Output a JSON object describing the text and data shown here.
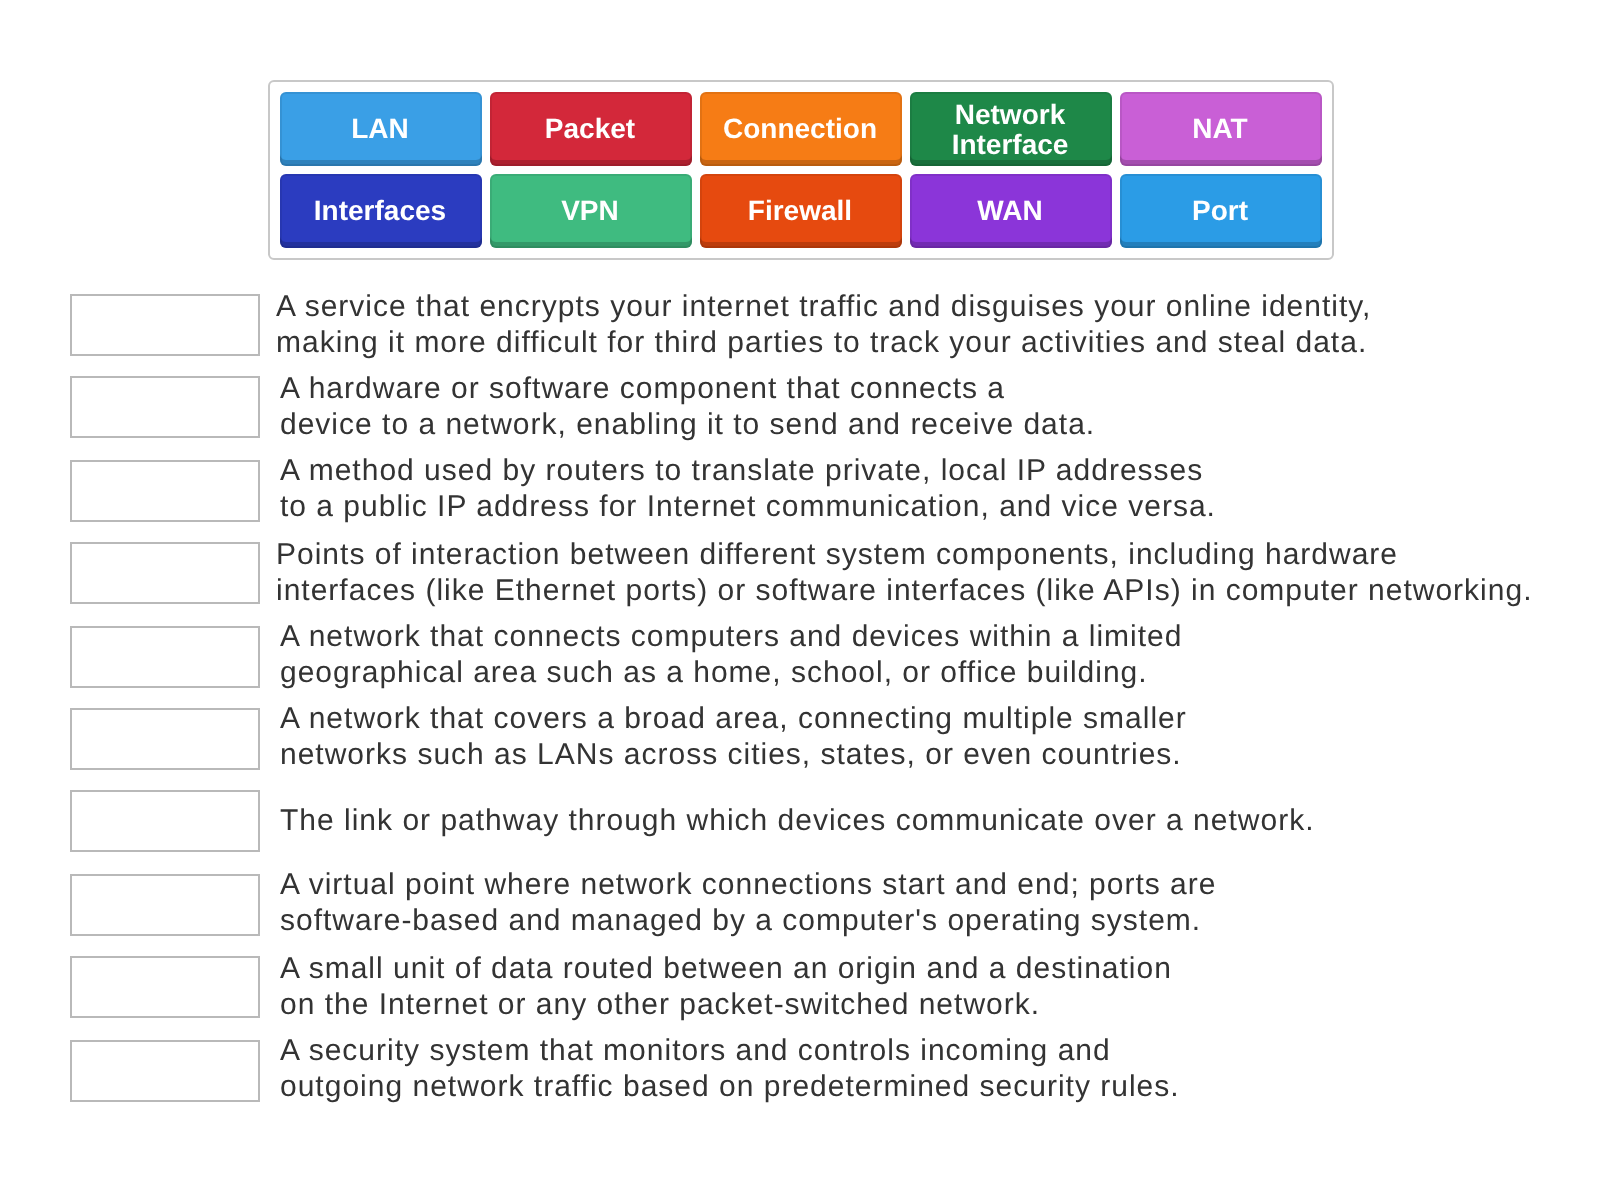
{
  "tiles": [
    {
      "label": "LAN",
      "color": "#3a9fe6"
    },
    {
      "label": "Packet",
      "color": "#d3283a"
    },
    {
      "label": "Connection",
      "color": "#f67c15"
    },
    {
      "label": "Network\nInterface",
      "color": "#1e8848"
    },
    {
      "label": "NAT",
      "color": "#c95fd6"
    },
    {
      "label": "Interfaces",
      "color": "#2b3cc0"
    },
    {
      "label": "VPN",
      "color": "#3fbb80"
    },
    {
      "label": "Firewall",
      "color": "#e64a0f"
    },
    {
      "label": "WAN",
      "color": "#8b35d9"
    },
    {
      "label": "Port",
      "color": "#2b9ce6"
    }
  ],
  "definitions": [
    {
      "text": "A service that encrypts your internet traffic and disguises your online identity,\nmaking it more difficult for third parties to track your activities and steal data."
    },
    {
      "text": "A hardware or software component that connects a\ndevice to a network, enabling it to send and receive data."
    },
    {
      "text": "A method used by routers to translate private, local IP addresses\nto a public IP address for Internet communication, and vice versa."
    },
    {
      "text": "Points of interaction between different system components, including hardware\ninterfaces (like Ethernet ports) or software interfaces (like APIs) in computer networking."
    },
    {
      "text": "A network that connects computers and devices within a limited\ngeographical area such as a home, school, or office building."
    },
    {
      "text": "A network that covers a broad area, connecting multiple smaller\nnetworks such as LANs across cities, states, or even countries."
    },
    {
      "text": "The link or pathway through which devices communicate over a network."
    },
    {
      "text": "A virtual point where network connections start and end; ports are\nsoftware-based and managed by a computer's operating system."
    },
    {
      "text": "A small unit of data routed between an origin and a destination\non the Internet or any other packet-switched network."
    },
    {
      "text": "A security system that monitors and controls incoming and\noutgoing network traffic based on predetermined security rules."
    }
  ]
}
